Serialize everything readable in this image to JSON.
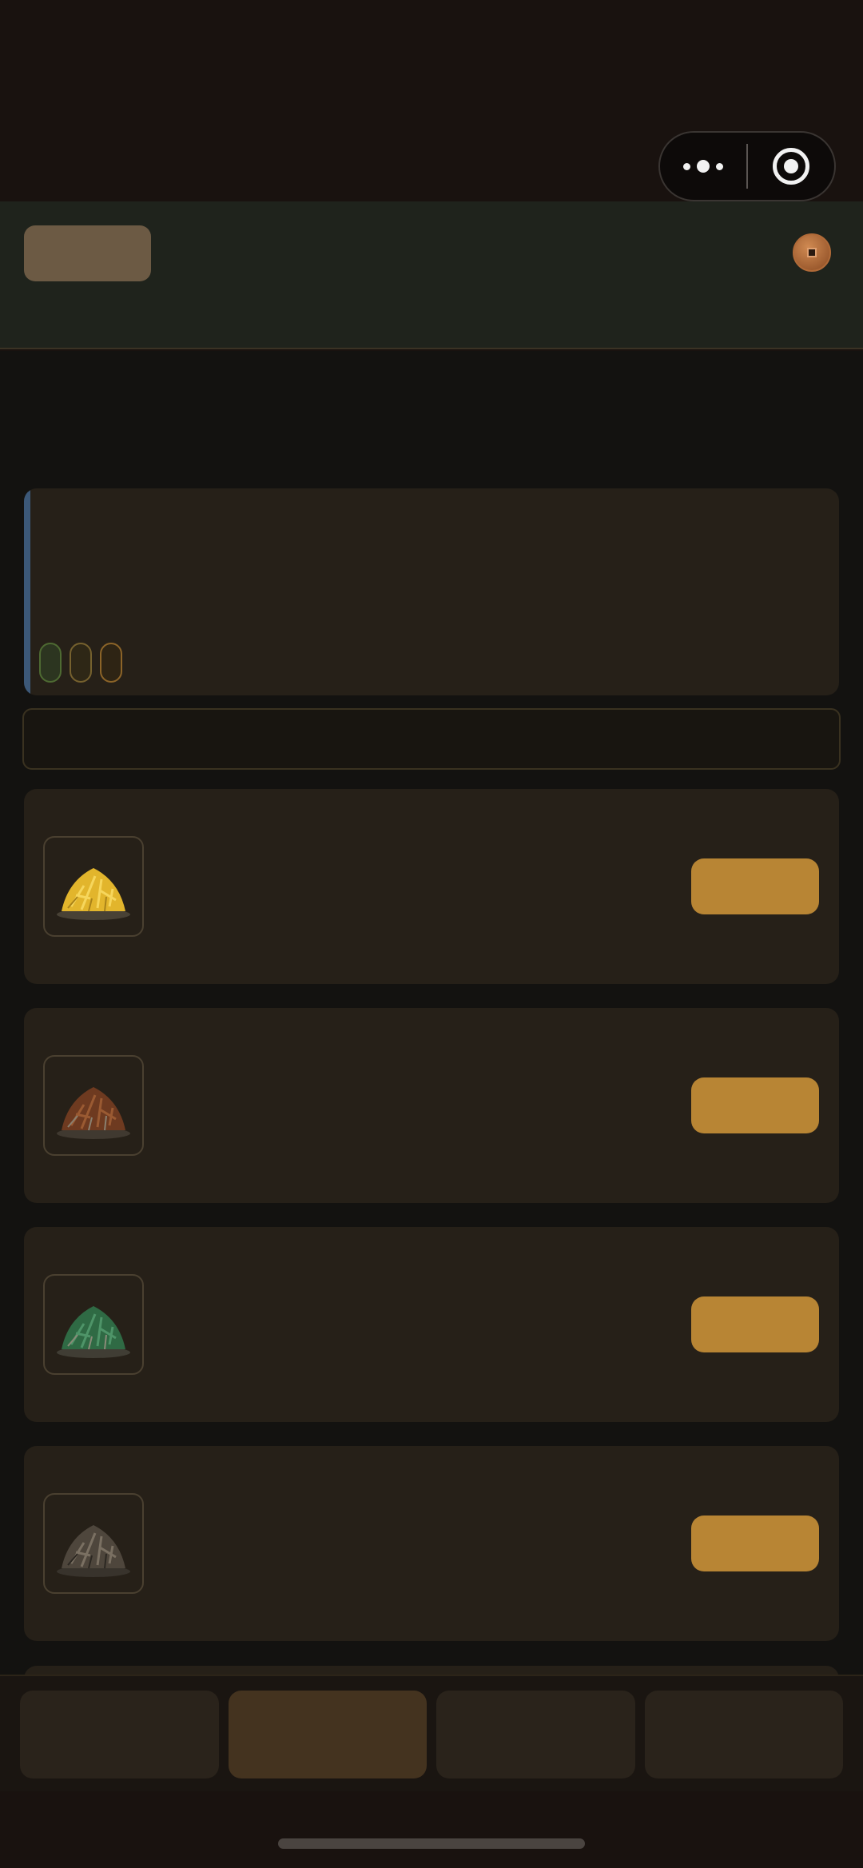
{
  "app": {
    "colors": {
      "background": "#19120f",
      "header": "#1f231c",
      "card": "#262018",
      "accent_button": "#b88534",
      "featured_accent": "#3c5878",
      "nav_active": "#44331f"
    }
  },
  "capsule": {
    "more_icon": "more-dots-icon",
    "close_icon": "target-close-icon"
  },
  "header": {
    "badge_icon": "coin-icon"
  },
  "featured": {
    "tags": [
      "green",
      "olive",
      "orange"
    ]
  },
  "search": {
    "placeholder": ""
  },
  "tea_list": [
    {
      "leaf": "yellow-tea",
      "leaf_color": "#e2b52c",
      "action_label": ""
    },
    {
      "leaf": "red-tea",
      "leaf_color": "#7a3e22",
      "action_label": ""
    },
    {
      "leaf": "green-tea",
      "leaf_color": "#3f7a50",
      "action_label": ""
    },
    {
      "leaf": "dark-tea",
      "leaf_color": "#5c544a",
      "action_label": ""
    }
  ],
  "bottom_nav": {
    "tab_count": 4,
    "active_index": 1
  }
}
